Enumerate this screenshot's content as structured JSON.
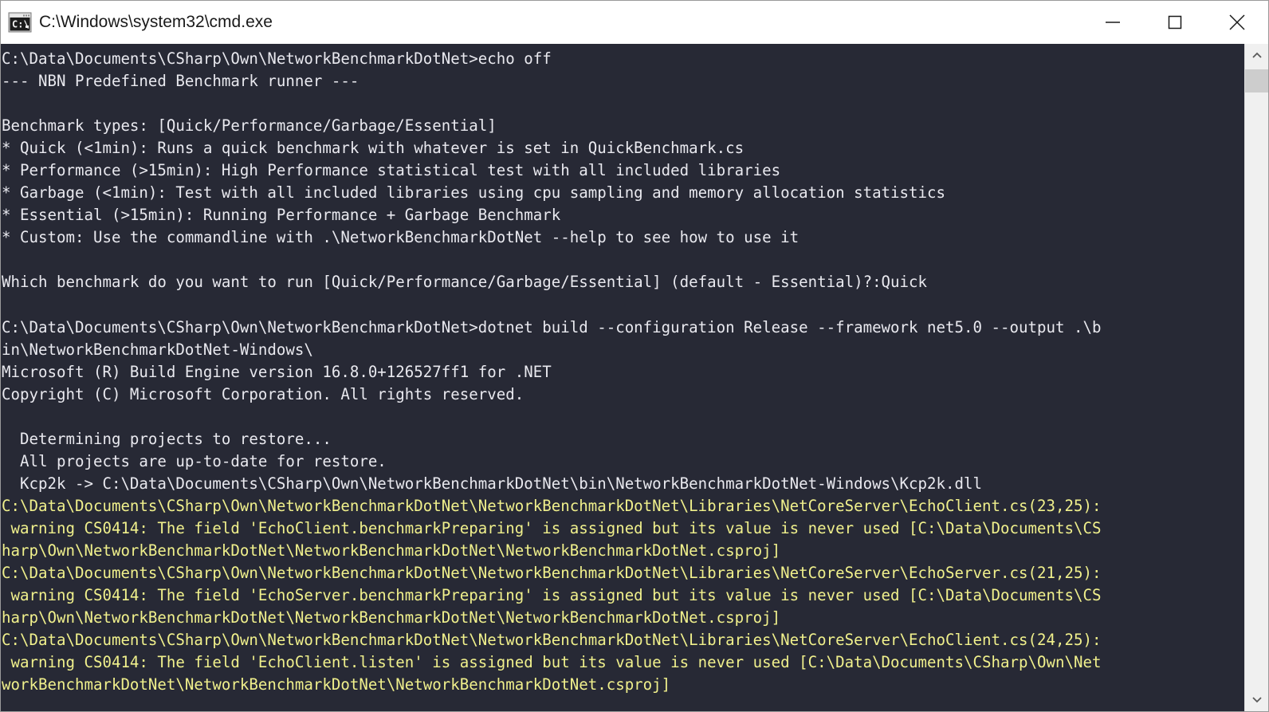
{
  "window": {
    "title": "C:\\Windows\\system32\\cmd.exe",
    "icon": "cmd-console-icon",
    "controls": [
      {
        "name": "minimize-button",
        "glyph": "minimize"
      },
      {
        "name": "maximize-button",
        "glyph": "maximize"
      },
      {
        "name": "close-button",
        "glyph": "close"
      }
    ]
  },
  "colors": {
    "console_background": "#272935",
    "console_foreground": "#e9e9ef",
    "warning_foreground": "#f0f08c",
    "titlebar_background": "#ffffff",
    "titlebar_foreground": "#1a1a1a",
    "scrollbar_track": "#f0f0f0",
    "scrollbar_thumb": "#cdcdcd"
  },
  "scrollbar": {
    "up_arrow_label": "scroll-up",
    "down_arrow_label": "scroll-down",
    "thumb_label": "scroll-thumb"
  },
  "console": {
    "lines": [
      {
        "text": "C:\\Data\\Documents\\CSharp\\Own\\NetworkBenchmarkDotNet>echo off",
        "color": "white"
      },
      {
        "text": "--- NBN Predefined Benchmark runner ---",
        "color": "white"
      },
      {
        "text": "",
        "color": "white"
      },
      {
        "text": "Benchmark types: [Quick/Performance/Garbage/Essential]",
        "color": "white"
      },
      {
        "text": "* Quick (<1min): Runs a quick benchmark with whatever is set in QuickBenchmark.cs",
        "color": "white"
      },
      {
        "text": "* Performance (>15min): High Performance statistical test with all included libraries",
        "color": "white"
      },
      {
        "text": "* Garbage (<1min): Test with all included libraries using cpu sampling and memory allocation statistics",
        "color": "white"
      },
      {
        "text": "* Essential (>15min): Running Performance + Garbage Benchmark",
        "color": "white"
      },
      {
        "text": "* Custom: Use the commandline with .\\NetworkBenchmarkDotNet --help to see how to use it",
        "color": "white"
      },
      {
        "text": "",
        "color": "white"
      },
      {
        "text": "Which benchmark do you want to run [Quick/Performance/Garbage/Essential] (default - Essential)?:Quick",
        "color": "white"
      },
      {
        "text": "",
        "color": "white"
      },
      {
        "text": "C:\\Data\\Documents\\CSharp\\Own\\NetworkBenchmarkDotNet>dotnet build --configuration Release --framework net5.0 --output .\\b",
        "color": "white"
      },
      {
        "text": "in\\NetworkBenchmarkDotNet-Windows\\",
        "color": "white"
      },
      {
        "text": "Microsoft (R) Build Engine version 16.8.0+126527ff1 for .NET",
        "color": "white"
      },
      {
        "text": "Copyright (C) Microsoft Corporation. All rights reserved.",
        "color": "white"
      },
      {
        "text": "",
        "color": "white"
      },
      {
        "text": "  Determining projects to restore...",
        "color": "white"
      },
      {
        "text": "  All projects are up-to-date for restore.",
        "color": "white"
      },
      {
        "text": "  Kcp2k -> C:\\Data\\Documents\\CSharp\\Own\\NetworkBenchmarkDotNet\\bin\\NetworkBenchmarkDotNet-Windows\\Kcp2k.dll",
        "color": "white"
      },
      {
        "text": "C:\\Data\\Documents\\CSharp\\Own\\NetworkBenchmarkDotNet\\NetworkBenchmarkDotNet\\Libraries\\NetCoreServer\\EchoClient.cs(23,25):",
        "color": "yellow"
      },
      {
        "text": " warning CS0414: The field 'EchoClient.benchmarkPreparing' is assigned but its value is never used [C:\\Data\\Documents\\CS",
        "color": "yellow"
      },
      {
        "text": "harp\\Own\\NetworkBenchmarkDotNet\\NetworkBenchmarkDotNet\\NetworkBenchmarkDotNet.csproj]",
        "color": "yellow"
      },
      {
        "text": "C:\\Data\\Documents\\CSharp\\Own\\NetworkBenchmarkDotNet\\NetworkBenchmarkDotNet\\Libraries\\NetCoreServer\\EchoServer.cs(21,25):",
        "color": "yellow"
      },
      {
        "text": " warning CS0414: The field 'EchoServer.benchmarkPreparing' is assigned but its value is never used [C:\\Data\\Documents\\CS",
        "color": "yellow"
      },
      {
        "text": "harp\\Own\\NetworkBenchmarkDotNet\\NetworkBenchmarkDotNet\\NetworkBenchmarkDotNet.csproj]",
        "color": "yellow"
      },
      {
        "text": "C:\\Data\\Documents\\CSharp\\Own\\NetworkBenchmarkDotNet\\NetworkBenchmarkDotNet\\Libraries\\NetCoreServer\\EchoClient.cs(24,25):",
        "color": "yellow"
      },
      {
        "text": " warning CS0414: The field 'EchoClient.listen' is assigned but its value is never used [C:\\Data\\Documents\\CSharp\\Own\\Net",
        "color": "yellow"
      },
      {
        "text": "workBenchmarkDotNet\\NetworkBenchmarkDotNet\\NetworkBenchmarkDotNet.csproj]",
        "color": "yellow"
      }
    ]
  }
}
